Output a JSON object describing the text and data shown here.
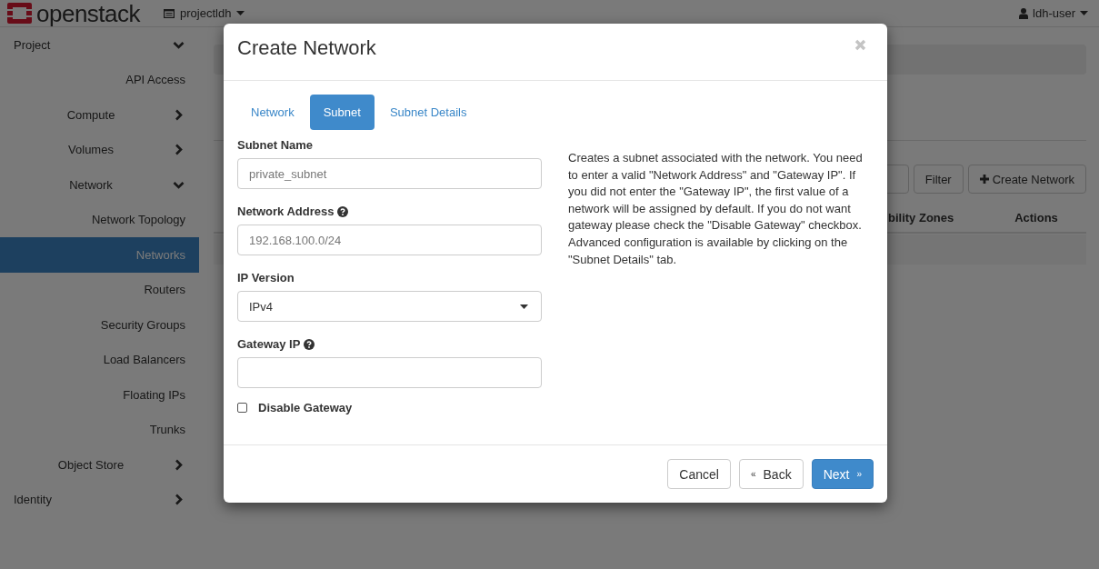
{
  "topbar": {
    "logo_text": "openstack",
    "project": "projectldh",
    "user": "ldh-user"
  },
  "sidebar": {
    "items": [
      {
        "label": "Project",
        "expanded": true,
        "selected": false,
        "children": [
          {
            "label": "API Access",
            "selected": false
          },
          {
            "label": "Compute",
            "expanded": false,
            "selected": false
          },
          {
            "label": "Volumes",
            "expanded": false,
            "selected": false
          },
          {
            "label": "Network",
            "expanded": true,
            "selected": false,
            "children": [
              {
                "label": "Network Topology",
                "selected": false
              },
              {
                "label": "Networks",
                "selected": true
              },
              {
                "label": "Routers",
                "selected": false
              },
              {
                "label": "Security Groups",
                "selected": false
              },
              {
                "label": "Load Balancers",
                "selected": false
              },
              {
                "label": "Floating IPs",
                "selected": false
              },
              {
                "label": "Trunks",
                "selected": false
              }
            ]
          },
          {
            "label": "Object Store",
            "expanded": false,
            "selected": false
          }
        ]
      },
      {
        "label": "Identity",
        "expanded": false,
        "selected": false
      }
    ]
  },
  "main": {
    "toolbar": [
      {
        "label": "Filter",
        "kind": "filter"
      },
      {
        "label": "Create Network",
        "kind": "create"
      }
    ],
    "table": {
      "columns": [
        "bility Zones",
        "Actions"
      ]
    }
  },
  "modal": {
    "title": "Create Network",
    "tabs": [
      {
        "label": "Network",
        "selected": false
      },
      {
        "label": "Subnet",
        "selected": true
      },
      {
        "label": "Subnet Details",
        "selected": false
      }
    ],
    "fields": [
      {
        "kind": "text",
        "label": "Subnet Name",
        "help": false,
        "placeholder": "private_subnet"
      },
      {
        "kind": "text",
        "label": "Network Address",
        "help": true,
        "placeholder": "192.168.100.0/24"
      },
      {
        "kind": "select",
        "label": "IP Version",
        "help": false,
        "value": "IPv4"
      },
      {
        "kind": "text",
        "label": "Gateway IP",
        "help": true
      },
      {
        "kind": "checkbox",
        "label": "Disable Gateway",
        "checked": false
      }
    ],
    "description": "Creates a subnet associated with the network. You need to enter a valid \"Network Address\" and \"Gateway IP\". If you did not enter the \"Gateway IP\", the first value of a network will be assigned by default. If you do not want gateway please check the \"Disable Gateway\" checkbox. Advanced configuration is available by clicking on the \"Subnet Details\" tab.",
    "buttons": [
      {
        "label": "Cancel",
        "kind": "default"
      },
      {
        "label": "Back",
        "kind": "default",
        "prefix": "«"
      },
      {
        "label": "Next",
        "kind": "primary",
        "suffix": "»"
      }
    ]
  }
}
